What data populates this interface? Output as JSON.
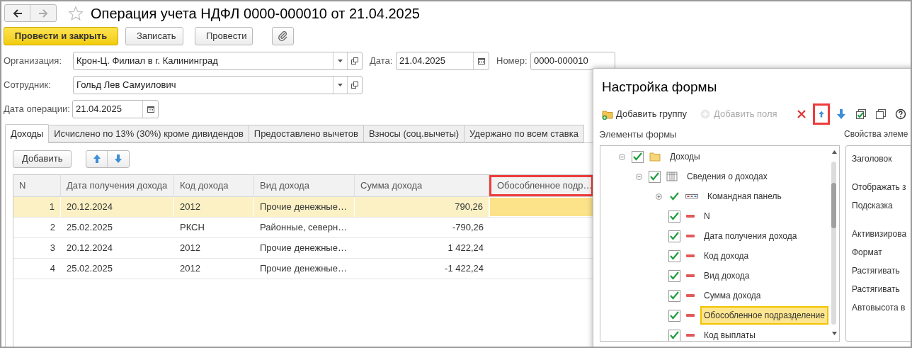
{
  "window": {
    "title": "Операция учета НДФЛ 0000-000010 от 21.04.2025",
    "favorite": false
  },
  "toolbar": [
    {
      "kind": "primary",
      "label": "Провести и закрыть"
    },
    {
      "kind": "normal",
      "label": "Записать"
    },
    {
      "kind": "normal",
      "label": "Провести"
    },
    {
      "kind": "attach"
    }
  ],
  "fields": {
    "organization": {
      "label": "Организация:",
      "value": "Крон-Ц. Филиал в г. Калининград"
    },
    "date": {
      "label": "Дата:",
      "value": "21.04.2025"
    },
    "number": {
      "label": "Номер:",
      "value": "0000-000010"
    },
    "employee": {
      "label": "Сотрудник:",
      "value": "Гольд Лев Самуилович"
    },
    "operation_date": {
      "label": "Дата операции:",
      "value": "21.04.2025"
    }
  },
  "tabs": [
    {
      "label": "Доходы",
      "selected": true
    },
    {
      "label": "Исчислено по 13% (30%) кроме дивидендов",
      "selected": false
    },
    {
      "label": "Предоставлено вычетов",
      "selected": false
    },
    {
      "label": "Взносы (соц.вычеты)",
      "selected": false
    },
    {
      "label": "Удержано по всем ставка",
      "selected": false
    }
  ],
  "table": {
    "add_button": "Добавить",
    "columns": [
      {
        "label": "N",
        "kind": "number",
        "highlighted": false,
        "current": false
      },
      {
        "label": "Дата получения дохода",
        "kind": "text",
        "highlighted": false,
        "current": false
      },
      {
        "label": "Код дохода",
        "kind": "text",
        "highlighted": false,
        "current": false
      },
      {
        "label": "Вид дохода",
        "kind": "text",
        "highlighted": false,
        "current": false
      },
      {
        "label": "Сумма дохода",
        "kind": "number",
        "highlighted": false,
        "current": false
      },
      {
        "label": "Обособленное подр…",
        "kind": "text",
        "highlighted": true,
        "current": true
      }
    ],
    "rows": [
      {
        "selected": true,
        "cells": [
          "1",
          "20.12.2024",
          "2012",
          "Прочие денежные…",
          "790,26",
          ""
        ]
      },
      {
        "selected": false,
        "cells": [
          "2",
          "25.02.2025",
          "РКСН",
          "Районные, северн…",
          "-790,26",
          ""
        ]
      },
      {
        "selected": false,
        "cells": [
          "3",
          "20.12.2024",
          "2012",
          "Прочие денежные…",
          "1 422,24",
          ""
        ]
      },
      {
        "selected": false,
        "cells": [
          "4",
          "25.02.2025",
          "2012",
          "Прочие денежные…",
          "-1 422,24",
          ""
        ]
      }
    ]
  },
  "dialog": {
    "title": "Настройка формы",
    "tools": [
      {
        "kind": "add_group",
        "label": "Добавить группу",
        "disabled": false
      },
      {
        "kind": "add_fields",
        "label": "Добавить поля",
        "disabled": true
      },
      {
        "kind": "delete",
        "disabled": false
      },
      {
        "kind": "up",
        "disabled": false,
        "highlighted": true
      },
      {
        "kind": "down",
        "disabled": false
      },
      {
        "kind": "check_all",
        "disabled": false
      },
      {
        "kind": "copy",
        "disabled": false
      },
      {
        "kind": "help",
        "disabled": false
      }
    ],
    "elements_label": "Элементы формы",
    "properties_label": "Свойства элеме",
    "tree": [
      {
        "kind": "folder",
        "label": "Доходы",
        "checked": true,
        "expanded": true,
        "selected": false,
        "children": [
          {
            "kind": "table",
            "label": "Сведения о доходах",
            "checked": true,
            "expanded": true,
            "selected": false,
            "children": [
              {
                "kind": "panel",
                "label": "Командная панель",
                "checked": true,
                "expanded": false,
                "selected": false
              },
              {
                "kind": "field",
                "label": "N",
                "checked": true,
                "selected": false
              },
              {
                "kind": "field",
                "label": "Дата получения дохода",
                "checked": true,
                "selected": false
              },
              {
                "kind": "field",
                "label": "Код дохода",
                "checked": true,
                "selected": false
              },
              {
                "kind": "field",
                "label": "Вид дохода",
                "checked": true,
                "selected": false
              },
              {
                "kind": "field",
                "label": "Сумма дохода",
                "checked": true,
                "selected": false
              },
              {
                "kind": "field",
                "label": "Обособленное подразделение",
                "checked": true,
                "selected": true
              },
              {
                "kind": "field",
                "label": "Код выплаты",
                "checked": true,
                "selected": false
              }
            ]
          }
        ]
      }
    ],
    "properties": [
      "Заголовок",
      "Отображать з",
      "Подсказка",
      "Активизирова",
      "Формат",
      "Растягивать",
      "Растягивать",
      "Автовысота в"
    ]
  }
}
